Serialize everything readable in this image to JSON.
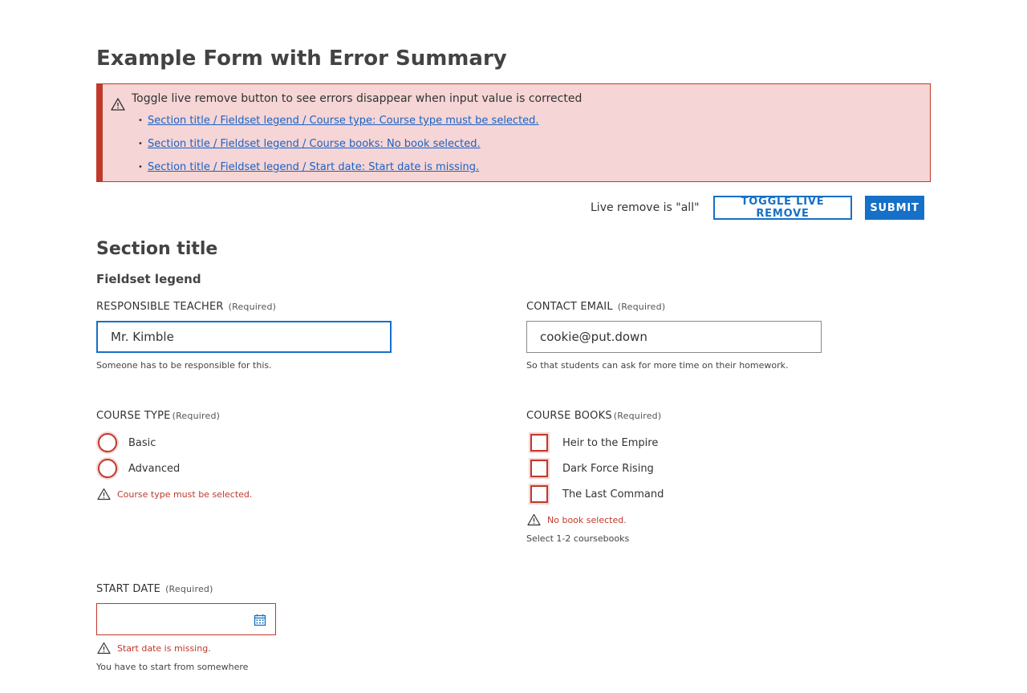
{
  "page": {
    "title": "Example Form with Error Summary"
  },
  "error_summary": {
    "heading": "Toggle live remove button to see errors disappear when input value is corrected",
    "items": [
      "Section title / Fieldset legend / Course type: Course type must be selected.",
      "Section title / Fieldset legend / Course books: No book selected.",
      "Section title / Fieldset legend / Start date: Start date is missing."
    ]
  },
  "actions": {
    "live_status": "Live remove is \"all\"",
    "toggle_label": "Toggle live remove",
    "submit_label": "Submit"
  },
  "section": {
    "title": "Section title",
    "legend": "Fieldset legend"
  },
  "fields": {
    "teacher": {
      "label": "RESPONSIBLE TEACHER",
      "required": "(Required)",
      "value": "Mr. Kimble",
      "help": "Someone has to be responsible for this."
    },
    "email": {
      "label": "CONTACT EMAIL",
      "required": "(Required)",
      "value": "cookie@put.down",
      "help": "So that students can ask for more time on their homework."
    },
    "course_type": {
      "label": "COURSE TYPE",
      "required": "(Required)",
      "options": [
        "Basic",
        "Advanced"
      ],
      "error": "Course type must be selected."
    },
    "course_books": {
      "label": "COURSE BOOKS",
      "required": "(Required)",
      "options": [
        "Heir to the Empire",
        "Dark Force Rising",
        "The Last Command"
      ],
      "error": "No book selected.",
      "help": "Select 1-2 coursebooks"
    },
    "start_date": {
      "label": "START DATE",
      "required": "(Required)",
      "value": "",
      "error": "Start date is missing.",
      "help": "You have to start from somewhere"
    }
  },
  "colors": {
    "primary": "#1670c7",
    "error": "#c0392b",
    "error_bg": "#f5d5d5",
    "link": "#1a62c5"
  }
}
